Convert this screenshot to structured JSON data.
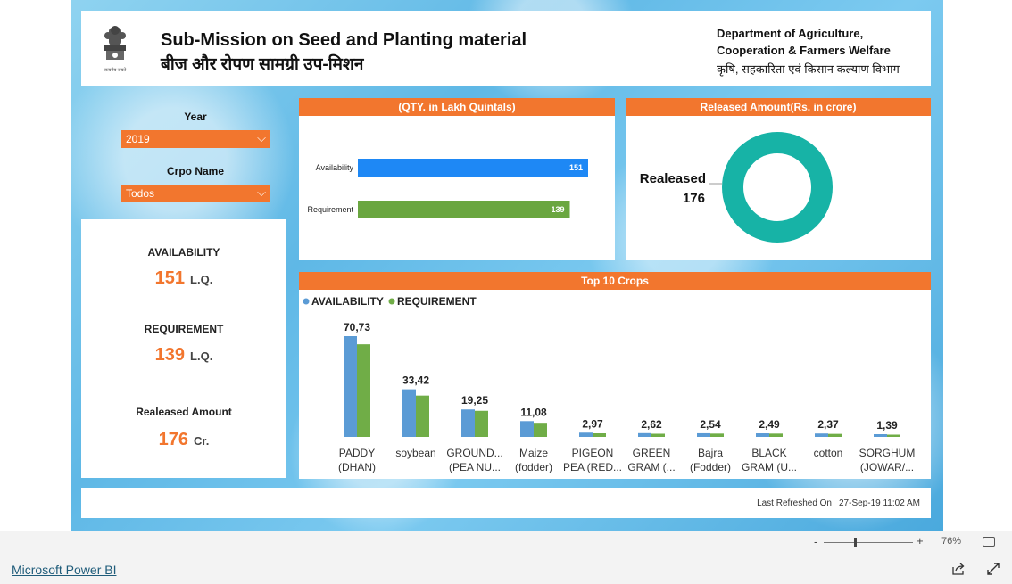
{
  "header": {
    "title_en": "Sub-Mission on Seed and Planting material",
    "title_hi": "बीज और रोपण सामग्री उप-मिशन",
    "dept_en_line1": "Department of Agriculture,",
    "dept_en_line2": "Cooperation & Farmers Welfare",
    "dept_hi": "कृषि, सहकारिता एवं किसान कल्याण विभाग",
    "emblem_caption": "सत्यमेव जयते"
  },
  "filters": {
    "year_label": "Year",
    "year_value": "2019",
    "crop_label": "Crpo Name",
    "crop_value": "Todos"
  },
  "kpis": {
    "availability_label": "AVAILABILITY",
    "availability_value": "151",
    "availability_unit": "L.Q.",
    "requirement_label": "REQUIREMENT",
    "requirement_value": "139",
    "requirement_unit": "L.Q.",
    "released_label": "Realeased Amount",
    "released_value": "176",
    "released_unit": "Cr."
  },
  "qty_panel": {
    "title": "(QTY. in Lakh Quintals)"
  },
  "released_panel": {
    "title": "Released Amount(Rs. in crore)",
    "center_label": "Realeased",
    "center_value": "176"
  },
  "top10_panel": {
    "title": "Top 10 Crops"
  },
  "footer": {
    "refresh_label": "Last Refreshed On",
    "refresh_time": "27-Sep-19 11:02 AM"
  },
  "statusbar": {
    "zoom_minus": "-",
    "zoom_plus": "+",
    "zoom": "76%"
  },
  "bottombar": {
    "link": "Microsoft Power BI"
  },
  "colors": {
    "orange": "#f2762e",
    "availability": "#1e88f5",
    "requirement": "#6aa640",
    "donut": "#17b3a6",
    "avail_col": "#5b9bd5",
    "req_col": "#70ad47"
  },
  "chart_data": [
    {
      "type": "bar",
      "orientation": "horizontal",
      "title": "(QTY. in Lakh Quintals)",
      "categories": [
        "Availability",
        "Requirement"
      ],
      "values": [
        151,
        139
      ],
      "colors": [
        "#1e88f5",
        "#6aa640"
      ]
    },
    {
      "type": "pie",
      "style": "donut",
      "title": "Released Amount(Rs. in crore)",
      "labels": [
        "Realeased"
      ],
      "values": [
        176
      ],
      "colors": [
        "#17b3a6"
      ]
    },
    {
      "type": "bar",
      "title": "Top 10 Crops",
      "legend": "top-left",
      "categories": [
        [
          "PADDY",
          "(DHAN)"
        ],
        [
          "soybean"
        ],
        [
          "GROUND...",
          "(PEA NU..."
        ],
        [
          "Maize",
          "(fodder)"
        ],
        [
          "PIGEON",
          "PEA (RED..."
        ],
        [
          "GREEN",
          "GRAM (..."
        ],
        [
          "Bajra",
          "(Fodder)"
        ],
        [
          "BLACK",
          "GRAM (U..."
        ],
        [
          "cotton"
        ],
        [
          "SORGHUM",
          "(JOWAR/..."
        ]
      ],
      "series": [
        {
          "name": "AVAILABILITY",
          "values": [
            70.73,
            33.42,
            19.25,
            11.08,
            2.97,
            2.62,
            2.54,
            2.49,
            2.37,
            1.39
          ]
        },
        {
          "name": "REQUIREMENT",
          "values": [
            65.0,
            29.0,
            18.3,
            9.9,
            2.5,
            2.2,
            2.3,
            2.3,
            2.1,
            1.2
          ]
        }
      ],
      "data_labels": [
        "70,73",
        "33,42",
        "19,25",
        "11,08",
        "2,97",
        "2,62",
        "2,54",
        "2,49",
        "2,37",
        "1,39"
      ]
    }
  ]
}
